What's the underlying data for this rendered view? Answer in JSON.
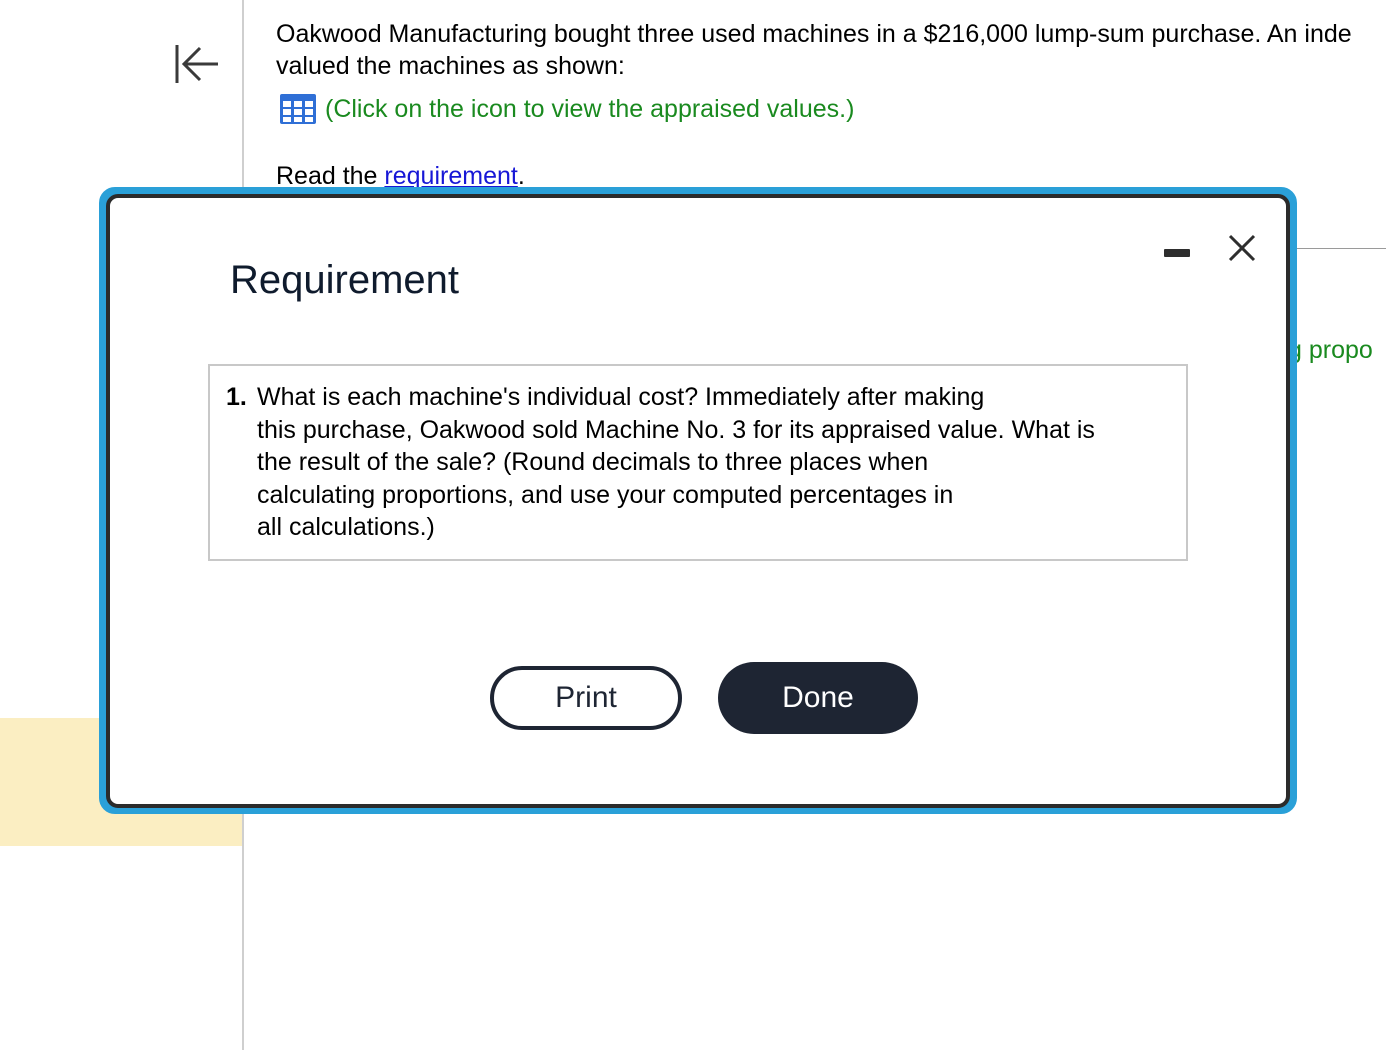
{
  "background": {
    "question_line1": "Oakwood Manufacturing bought three used machines in a $216,000 lump-sum purchase. An inde",
    "question_line2": "valued the machines as shown:",
    "appraised_link": "(Click on the icon to view the appraised values.)",
    "read_prefix": "Read the ",
    "read_link": "requirement",
    "read_suffix": ".",
    "right_partial_text": "g propo"
  },
  "modal": {
    "title": "Requirement",
    "requirement": {
      "number": "1.",
      "lines": [
        "What is each machine's individual cost? Immediately after making",
        "this purchase, Oakwood sold Machine No. 3 for its appraised value. What is",
        "the result of the sale? (Round decimals to three places when",
        "calculating proportions, and use your computed percentages in",
        "all calculations.)"
      ]
    },
    "print_label": "Print",
    "done_label": "Done"
  },
  "colors": {
    "modal_frame": "#2aa0d8",
    "link_green": "#1a8a1f",
    "link_blue": "#1717d6",
    "done_bg": "#1e2533",
    "highlight_band": "#fbeec2"
  },
  "icons": {
    "collapse": "collapse-left-icon",
    "table": "table-grid-icon",
    "minimize": "minimize-icon",
    "close": "close-icon"
  }
}
